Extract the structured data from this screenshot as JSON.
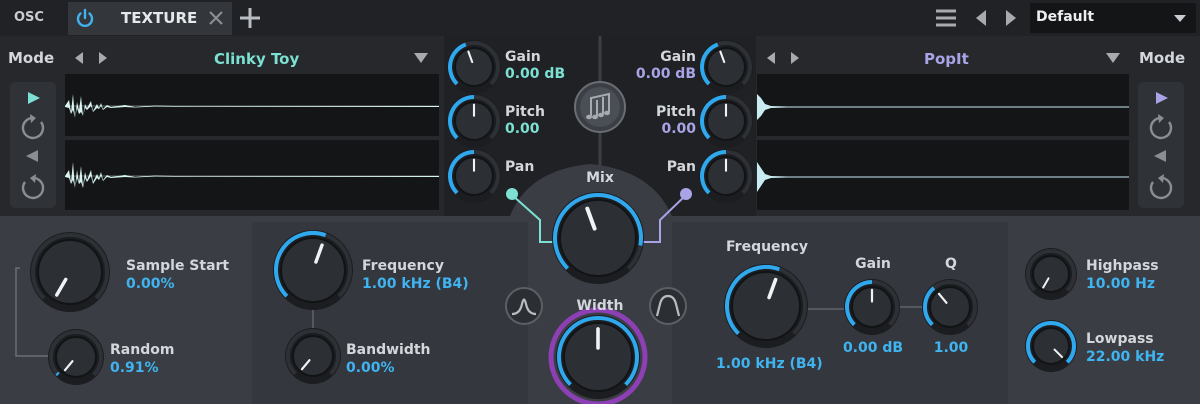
{
  "header": {
    "osc_label": "OSC",
    "tab_label": "TEXTURE",
    "preset": "Default"
  },
  "colors": {
    "accent_blue": "#2fa8ee",
    "teal": "#7ce0d2",
    "purple": "#a8a4e6",
    "magenta": "#8d3fb4"
  },
  "left": {
    "mode_label": "Mode",
    "sample_name": "Clinky Toy"
  },
  "right": {
    "mode_label": "Mode",
    "sample_name": "PopIt"
  },
  "mixer": {
    "left": {
      "gain_label": "Gain",
      "gain_value": "0.00 dB",
      "pitch_label": "Pitch",
      "pitch_value": "0.00",
      "pan_label": "Pan"
    },
    "right": {
      "gain_label": "Gain",
      "gain_value": "0.00 dB",
      "pitch_label": "Pitch",
      "pitch_value": "0.00",
      "pan_label": "Pan"
    },
    "mix_label": "Mix",
    "width_label": "Width"
  },
  "bottom": {
    "sample_start": {
      "label": "Sample Start",
      "value": "0.00%"
    },
    "random": {
      "label": "Random",
      "value": "0.91%"
    },
    "band_frequency": {
      "label": "Frequency",
      "value": "1.00 kHz (B4)"
    },
    "bandwidth": {
      "label": "Bandwidth",
      "value": "0.00%"
    },
    "eq_frequency": {
      "label": "Frequency",
      "value": "1.00 kHz (B4)"
    },
    "eq_gain": {
      "label": "Gain",
      "value": "0.00 dB"
    },
    "eq_q": {
      "label": "Q",
      "value": "1.00"
    },
    "highpass": {
      "label": "Highpass",
      "value": "10.00 Hz"
    },
    "lowpass": {
      "label": "Lowpass",
      "value": "22.00 kHz"
    }
  }
}
